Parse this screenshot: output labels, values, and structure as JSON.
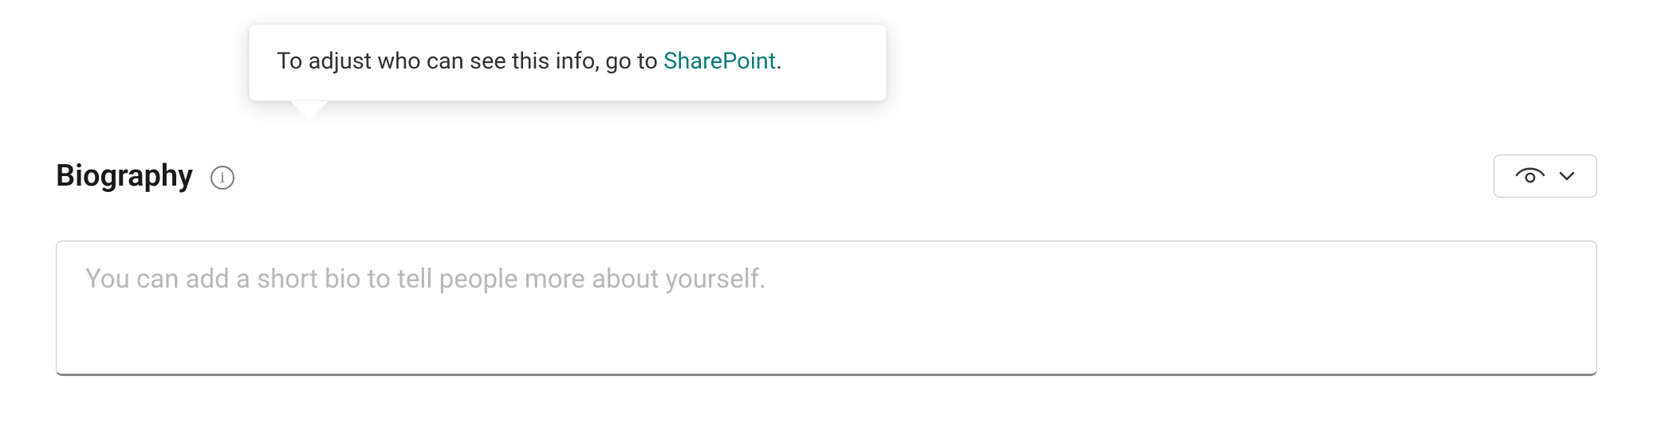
{
  "section": {
    "title": "Biography"
  },
  "tooltip": {
    "text_prefix": "To adjust who can see this info, go to ",
    "link_text": "SharePoint",
    "text_suffix": "."
  },
  "bio": {
    "value": "",
    "placeholder": "You can add a short bio to tell people more about yourself."
  }
}
